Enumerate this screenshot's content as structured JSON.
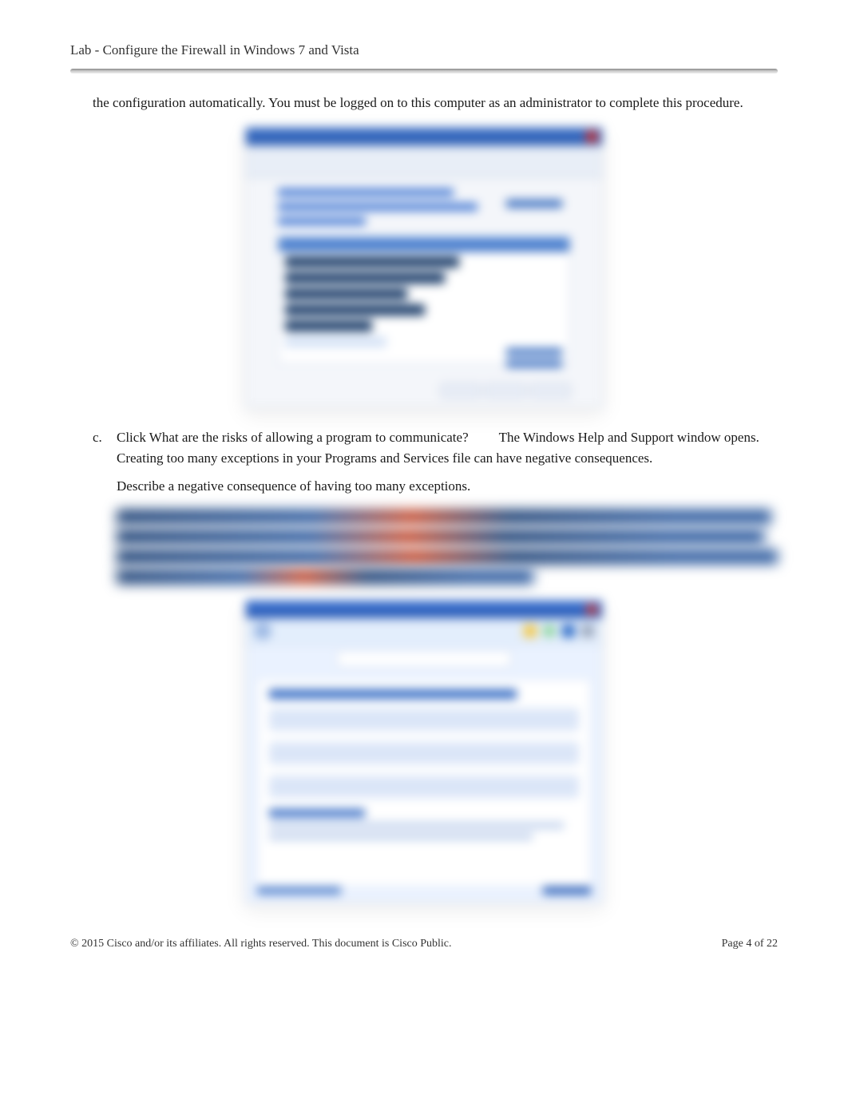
{
  "header": {
    "title": "Lab - Configure the Firewall in Windows 7 and Vista"
  },
  "intro": {
    "text": "the configuration automatically. You must be logged on to this computer as an administrator to complete this procedure."
  },
  "list_item_c": {
    "letter": "c.",
    "prefix": "Click ",
    "question": "What are the risks of allowing a program to communicate?",
    "transition": " The ",
    "window_name": "Windows Help and Support",
    "suffix": " window opens. Creating too many exceptions in your Programs and Services file can have negative consequences."
  },
  "question": {
    "text": "Describe a negative consequence of having too many exceptions."
  },
  "footer": {
    "copyright": "© 2015 Cisco and/or its affiliates. All rights reserved. This document is Cisco Public.",
    "page_label": "Page ",
    "page_number": "4",
    "page_of": " of 22"
  }
}
